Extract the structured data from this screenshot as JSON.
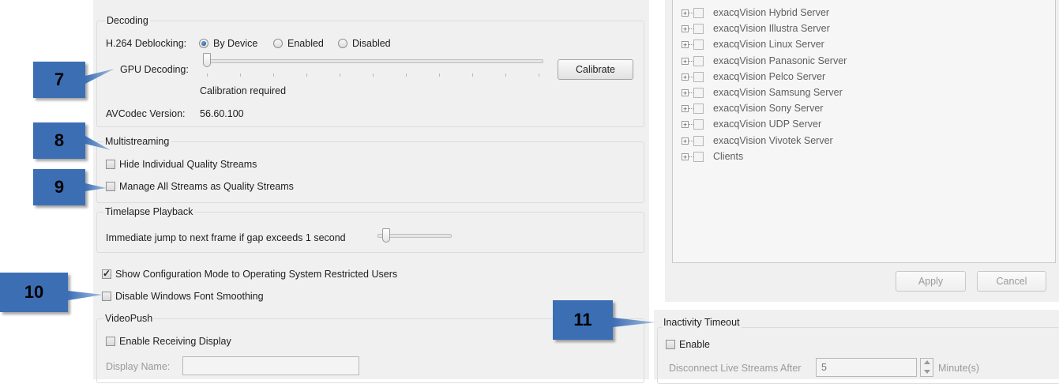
{
  "decoding": {
    "title": "Decoding",
    "deblocking_label": "H.264 Deblocking:",
    "deblocking_options": [
      "By Device",
      "Enabled",
      "Disabled"
    ],
    "deblocking_selected": "By Device",
    "gpu_label": "GPU Decoding:",
    "gpu_level": 0,
    "calibration_status": "Calibration required",
    "calibrate_button": "Calibrate",
    "avcodec_label": "AVCodec Version:",
    "avcodec_value": "56.60.100"
  },
  "multistreaming": {
    "title": "Multistreaming",
    "hide_individual": {
      "label": "Hide Individual Quality Streams",
      "checked": false
    },
    "manage_all": {
      "label": "Manage All Streams as Quality Streams",
      "checked": false
    }
  },
  "timelapse": {
    "title": "Timelapse Playback",
    "jump_label": "Immediate jump to next frame if gap exceeds 1 second",
    "jump_level": 0.1
  },
  "options": {
    "show_config": {
      "label": "Show Configuration Mode to Operating System Restricted Users",
      "checked": true
    },
    "disable_smoothing": {
      "label": "Disable Windows Font Smoothing",
      "checked": false
    }
  },
  "videopush": {
    "title": "VideoPush",
    "enable_receiving": {
      "label": "Enable Receiving Display",
      "checked": false
    },
    "display_name_label": "Display Name:",
    "display_name_value": ""
  },
  "tree": {
    "items": [
      "exacqVision Hybrid Server",
      "exacqVision Illustra Server",
      "exacqVision Linux Server",
      "exacqVision Panasonic Server",
      "exacqVision Pelco Server",
      "exacqVision Samsung Server",
      "exacqVision Sony Server",
      "exacqVision UDP Server",
      "exacqVision Vivotek Server",
      "Clients"
    ],
    "apply_button": "Apply",
    "cancel_button": "Cancel"
  },
  "inactivity": {
    "title": "Inactivity Timeout",
    "enable": {
      "label": "Enable",
      "checked": false
    },
    "disconnect_label": "Disconnect Live Streams After",
    "disconnect_value": "5",
    "unit": "Minute(s)"
  },
  "callouts": [
    "7",
    "8",
    "9",
    "10",
    "11"
  ],
  "colors": {
    "callout": "#3c6eb4",
    "panel": "#f0f0f0",
    "radio_selected": "#1c4f93"
  }
}
